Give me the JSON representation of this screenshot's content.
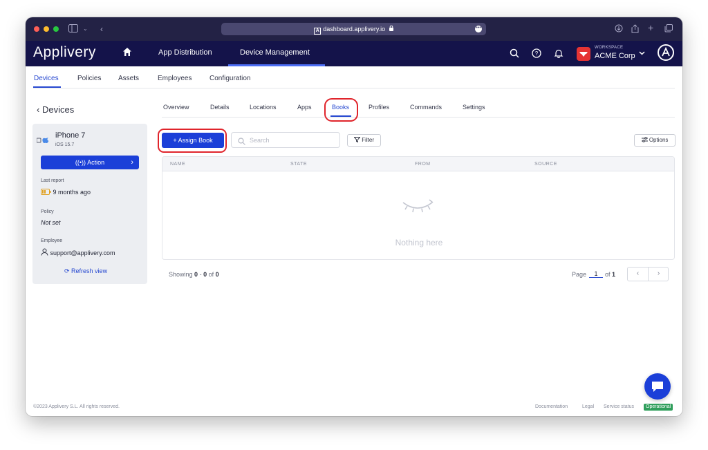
{
  "browser": {
    "url": "dashboard.applivery.io"
  },
  "header": {
    "brand": "Applivery",
    "nav": [
      "App Distribution",
      "Device Management"
    ],
    "workspace_label": "WORKSPACE",
    "workspace_name": "ACME Corp"
  },
  "subnav": {
    "items": [
      "Devices",
      "Policies",
      "Assets",
      "Employees",
      "Configuration"
    ],
    "active": "Devices"
  },
  "sidebar": {
    "back_label": "Devices",
    "device_name": "iPhone 7",
    "device_os": "iOS 15.7",
    "action_label": "Action",
    "last_report_label": "Last report",
    "last_report_value": "9 months ago",
    "policy_label": "Policy",
    "policy_value": "Not set",
    "employee_label": "Employee",
    "employee_value": "support@applivery.com",
    "refresh_label": "Refresh view"
  },
  "device_tabs": {
    "items": [
      "Overview",
      "Details",
      "Locations",
      "Apps",
      "Books",
      "Profiles",
      "Commands",
      "Settings"
    ],
    "active": "Books"
  },
  "toolbar": {
    "assign_label": "Assign Book",
    "search_placeholder": "Search",
    "filter_label": "Filter",
    "options_label": "Options"
  },
  "table": {
    "columns": [
      "NAME",
      "STATE",
      "FROM",
      "SOURCE"
    ],
    "rows": [],
    "empty_text": "Nothing here"
  },
  "pagination": {
    "showing_prefix": "Showing",
    "range_start": "0",
    "range_sep": "-",
    "range_end": "0",
    "of_label": "of",
    "total": "0",
    "page_label": "Page",
    "page": "1",
    "of_pages_label": "of",
    "total_pages": "1"
  },
  "footer": {
    "copyright": "©2023 Applivery S.L. All rights reserved.",
    "links": [
      "Documentation",
      "Legal",
      "Service status"
    ],
    "status": "Operational"
  },
  "colors": {
    "header_bg": "#14134a",
    "primary": "#1b3fd8",
    "highlight": "#e0242b",
    "status_ok": "#2f9e5b"
  }
}
